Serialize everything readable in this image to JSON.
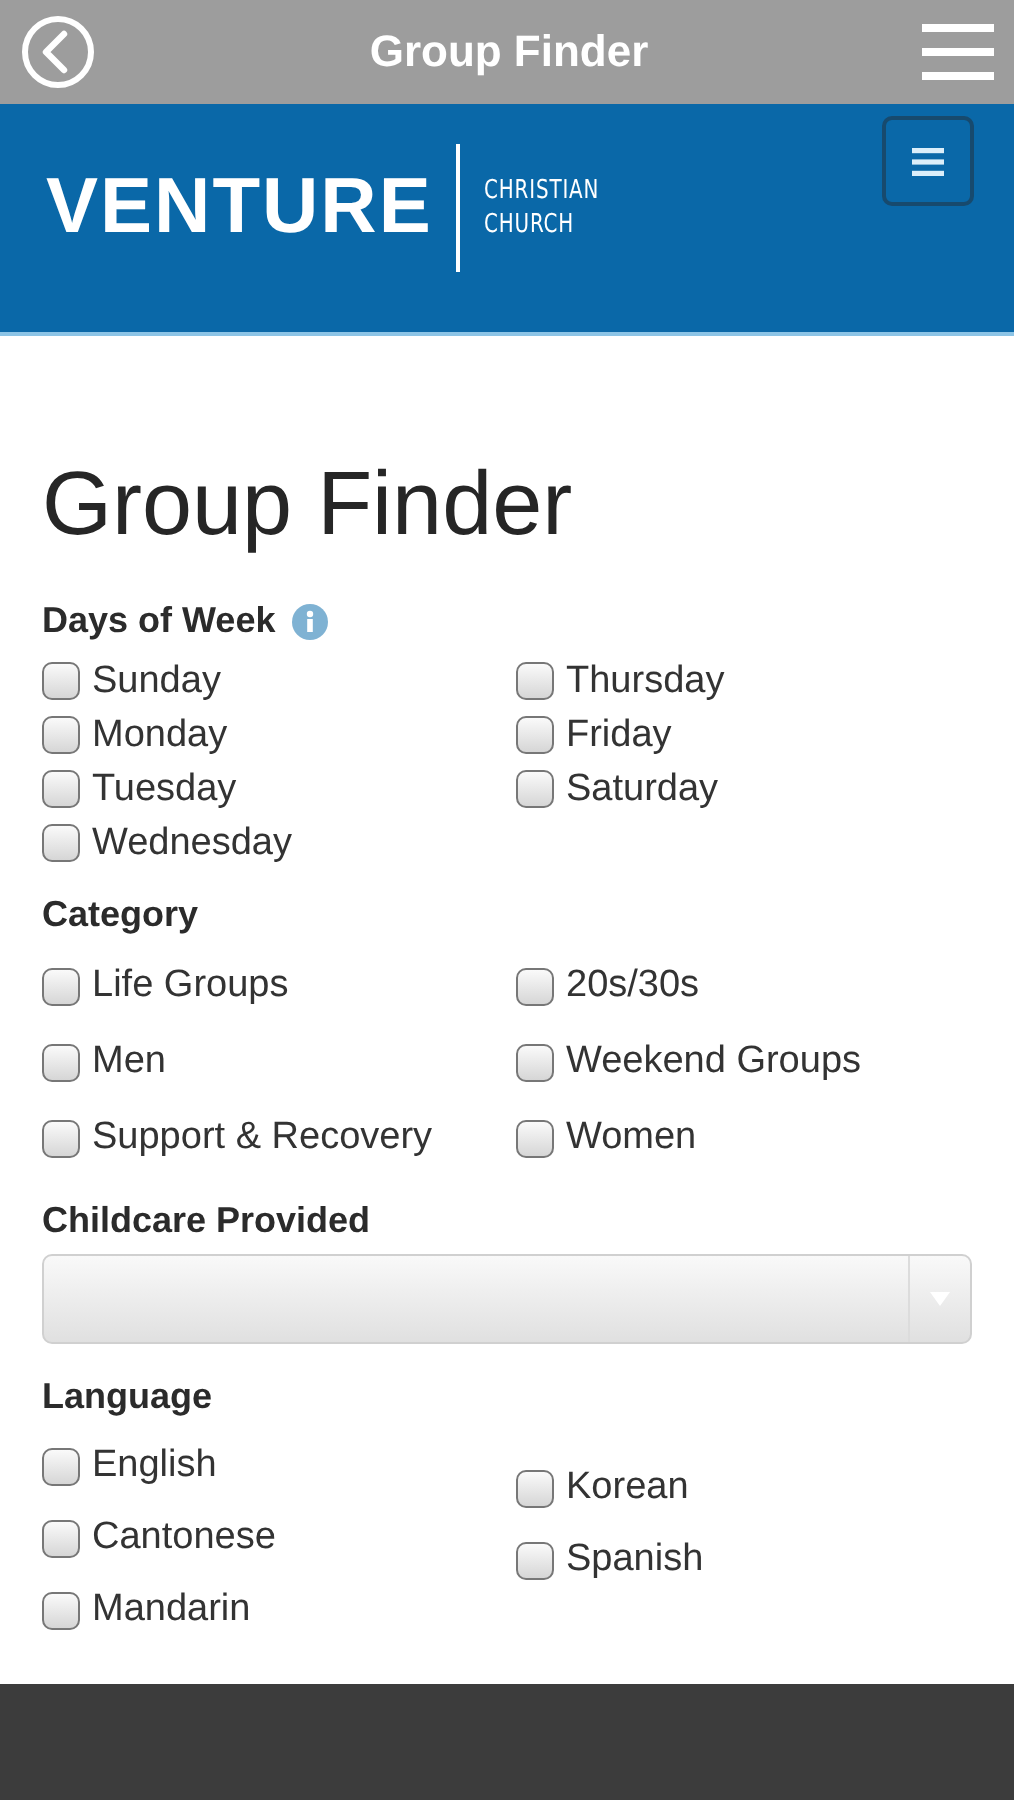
{
  "app_bar": {
    "title": "Group Finder"
  },
  "header": {
    "logo_word": "VENTURE",
    "logo_subtitle": [
      "CHRISTIAN",
      "CHURCH"
    ]
  },
  "page_title": "Group Finder",
  "sections": [
    {
      "kind": "checks",
      "label": "Days of Week",
      "info": true,
      "columns": [
        [
          {
            "label": "Sunday",
            "checked": false
          },
          {
            "label": "Monday",
            "checked": false
          },
          {
            "label": "Tuesday",
            "checked": false
          },
          {
            "label": "Wednesday",
            "checked": false
          }
        ],
        [
          {
            "label": "Thursday",
            "checked": false
          },
          {
            "label": "Friday",
            "checked": false
          },
          {
            "label": "Saturday",
            "checked": false
          }
        ]
      ]
    },
    {
      "kind": "checks",
      "label": "Category",
      "columns": [
        [
          {
            "label": "Life Groups",
            "checked": false
          },
          {
            "label": "Men",
            "checked": false
          },
          {
            "label": "Support & Recovery",
            "checked": false
          }
        ],
        [
          {
            "label": "20s/30s",
            "checked": false
          },
          {
            "label": "Weekend Groups",
            "checked": false
          },
          {
            "label": "Women",
            "checked": false
          }
        ]
      ]
    },
    {
      "kind": "select",
      "label": "Childcare Provided"
    },
    {
      "kind": "checks",
      "label": "Language",
      "columns": [
        [
          {
            "label": "English",
            "checked": false
          },
          {
            "label": "Cantonese",
            "checked": false
          },
          {
            "label": "Mandarin",
            "checked": false
          }
        ],
        [
          {
            "label": "Korean",
            "checked": false
          },
          {
            "label": "Spanish",
            "checked": false
          }
        ]
      ]
    }
  ]
}
